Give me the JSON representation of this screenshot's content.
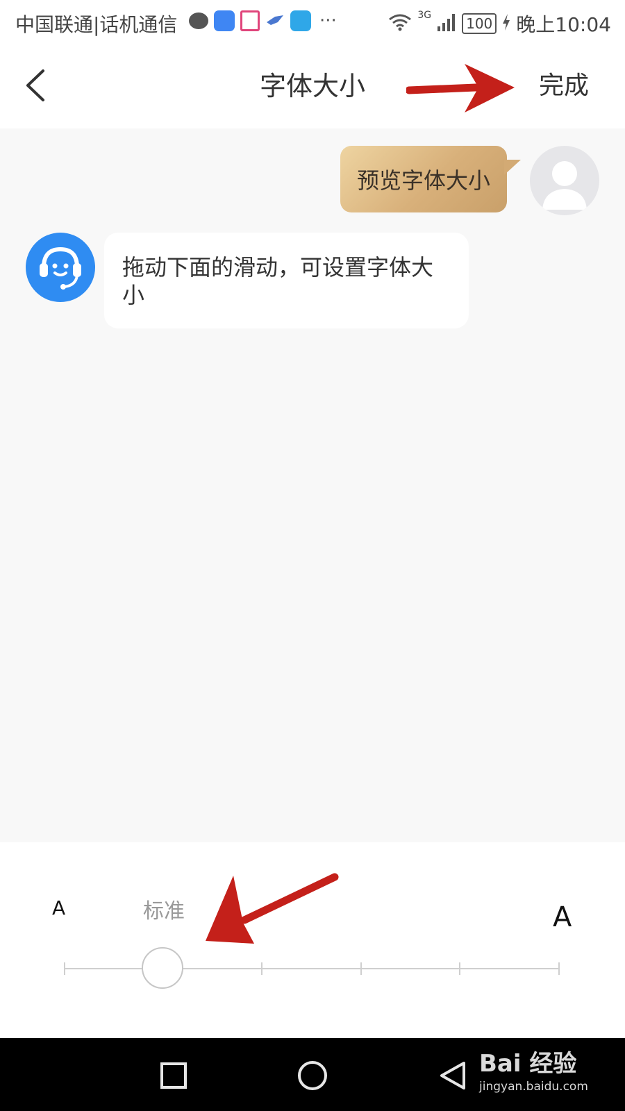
{
  "status_bar": {
    "carrier": "中国联通|话机通信",
    "network": "3G",
    "battery": "100",
    "time": "晚上10:04",
    "notification_icons": [
      "chat-bubble-icon",
      "lightbulb-app-icon",
      "doc-app-icon",
      "bird-app-icon",
      "edu-app-icon",
      "more-icon"
    ]
  },
  "header": {
    "title": "字体大小",
    "done_label": "完成",
    "back_icon": "chevron-left-icon"
  },
  "chat": {
    "outgoing_message": "预览字体大小",
    "incoming_message": "拖动下面的滑动，可设置字体大小",
    "bubble_gold": "#d8b07a",
    "bot_avatar_color": "#2f8cf2"
  },
  "font_size_panel": {
    "small_label": "A",
    "large_label": "A",
    "current_label": "标准",
    "levels": 6,
    "selected_level": 2
  },
  "system_nav": {
    "buttons": [
      "recents-square-icon",
      "home-circle-icon",
      "back-triangle-icon"
    ]
  },
  "watermark": {
    "logo": "Bai 经验",
    "url": "jingyan.baidu.com"
  },
  "annotation_color": "#c4201a"
}
